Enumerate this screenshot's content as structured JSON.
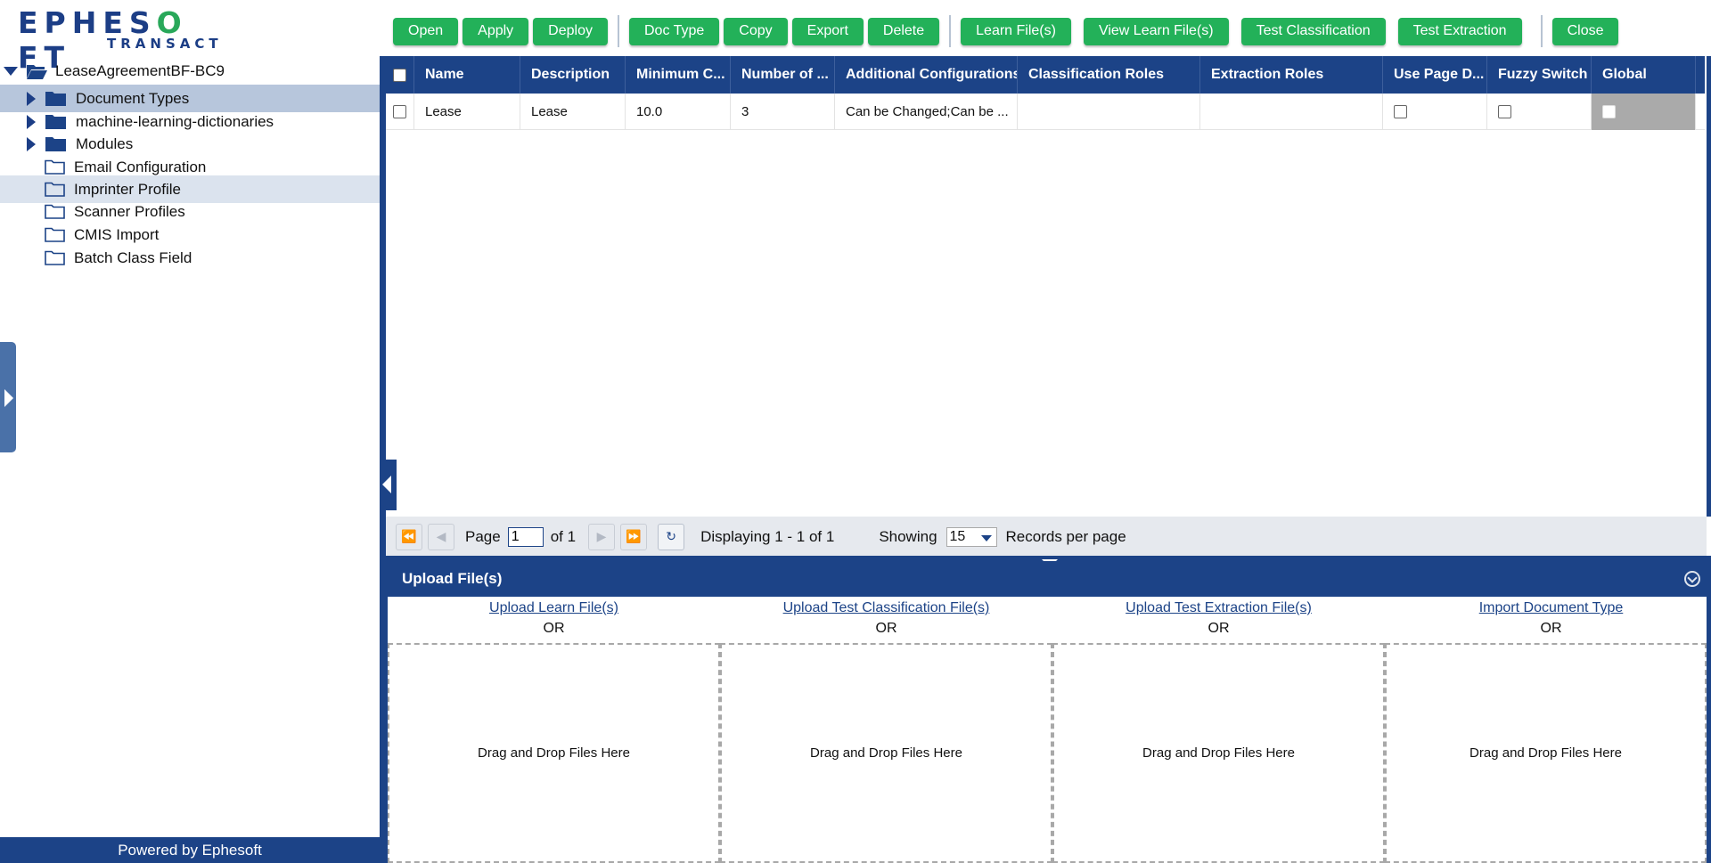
{
  "logo": {
    "main_left": "EPHES",
    "main_o": "O",
    "main_right": "FT",
    "sub": "TRANSACT"
  },
  "toolbar": {
    "group1": [
      "Open",
      "Apply",
      "Deploy"
    ],
    "group2": [
      "Doc Type",
      "Copy",
      "Export",
      "Delete"
    ],
    "group3": [
      "Learn File(s)",
      "View Learn File(s)",
      "Test Classification",
      "Test Extraction"
    ],
    "group4": [
      "Close"
    ]
  },
  "tree": {
    "root": "LeaseAgreementBF-BC9",
    "items": [
      {
        "label": "Document Types",
        "type": "expandable",
        "state": "selected"
      },
      {
        "label": "machine-learning-dictionaries",
        "type": "expandable",
        "state": ""
      },
      {
        "label": "Modules",
        "type": "expandable",
        "state": ""
      },
      {
        "label": "Email Configuration",
        "type": "leaf",
        "state": ""
      },
      {
        "label": "Imprinter Profile",
        "type": "leaf",
        "state": "hover"
      },
      {
        "label": "Scanner Profiles",
        "type": "leaf",
        "state": ""
      },
      {
        "label": "CMIS Import",
        "type": "leaf",
        "state": ""
      },
      {
        "label": "Batch Class Field",
        "type": "leaf",
        "state": ""
      }
    ],
    "footer": "Powered by Ephesoft"
  },
  "grid": {
    "columns": [
      "Name",
      "Description",
      "Minimum C...",
      "Number of ...",
      "Additional Configurations",
      "Classification Roles",
      "Extraction Roles",
      "Use Page D...",
      "Fuzzy Switch",
      "Global"
    ],
    "rows": [
      {
        "name": "Lease",
        "description": "Lease",
        "minimum": "10.0",
        "number": "3",
        "additional": "Can be Changed;Can be ...",
        "classification_roles": "",
        "extraction_roles": ""
      }
    ]
  },
  "pager": {
    "page_label": "Page",
    "page_value": "1",
    "of_label": "of 1",
    "displaying": "Displaying 1 - 1 of 1",
    "showing_label": "Showing",
    "per_page": "15",
    "records_label": "Records per page"
  },
  "upload": {
    "title": "Upload File(s)",
    "columns": [
      {
        "link": "Upload Learn File(s)",
        "or": "OR",
        "drop": "Drag and Drop Files Here"
      },
      {
        "link": "Upload Test Classification File(s)",
        "or": "OR",
        "drop": "Drag and Drop Files Here"
      },
      {
        "link": "Upload Test Extraction File(s)",
        "or": "OR",
        "drop": "Drag and Drop Files Here"
      },
      {
        "link": "Import Document Type",
        "or": "OR",
        "drop": "Drag and Drop Files Here"
      }
    ]
  }
}
